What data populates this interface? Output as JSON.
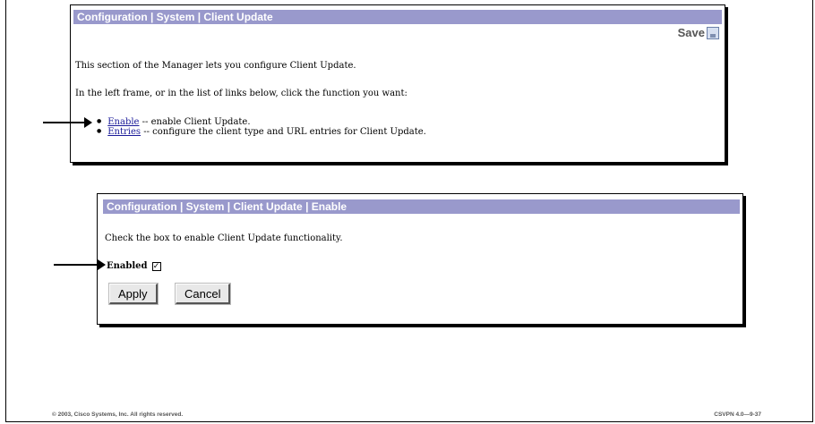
{
  "top_panel": {
    "title": "Configuration | System | Client Update",
    "save_label": "Save",
    "intro": "This section of the Manager lets you configure Client Update.",
    "instruction": "In the left frame, or in the list of links below, click the function you want:",
    "links": [
      {
        "label": "Enable",
        "description": " -- enable Client Update."
      },
      {
        "label": "Entries",
        "description": " -- configure the client type and URL entries for Client Update."
      }
    ]
  },
  "bottom_panel": {
    "title": "Configuration | System | Client Update | Enable",
    "instruction": "Check the box to enable Client Update functionality.",
    "enabled_label": "Enabled",
    "enabled_checked": true,
    "apply_label": "Apply",
    "cancel_label": "Cancel"
  },
  "footer": {
    "copyright": "© 2003, Cisco Systems, Inc. All rights reserved.",
    "course_code": "CSVPN 4.0—9-37"
  },
  "icons": {
    "save": "save-disk-icon",
    "pointer": "arrow-right-icon",
    "checkbox": "checkmark-icon"
  },
  "colors": {
    "titlebar": "#9999cc",
    "link": "#1a1a99"
  }
}
